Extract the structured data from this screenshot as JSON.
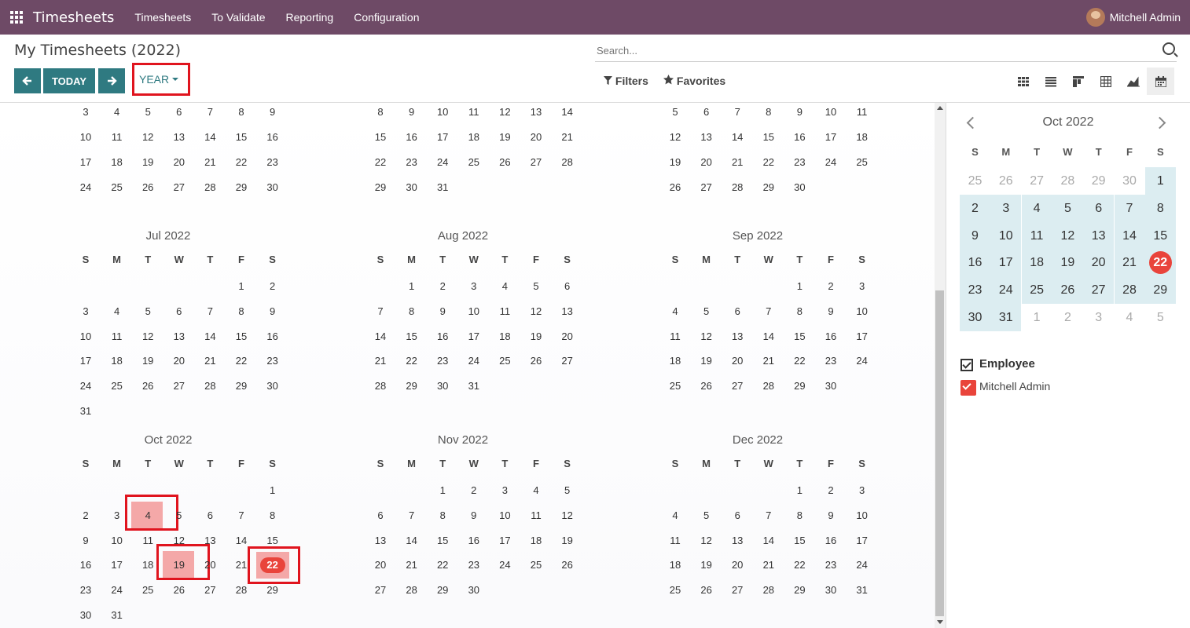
{
  "navbar": {
    "brand": "Timesheets",
    "menu": [
      "Timesheets",
      "To Validate",
      "Reporting",
      "Configuration"
    ],
    "user": "Mitchell Admin"
  },
  "control": {
    "title": "My Timesheets (2022)",
    "today_label": "TODAY",
    "scale_label": "YEAR",
    "search_placeholder": "Search...",
    "filters_label": "Filters",
    "favorites_label": "Favorites",
    "views": [
      "kanban-icon",
      "list-icon",
      "pivot-icon",
      "grid-icon",
      "graph-icon",
      "calendar-icon"
    ],
    "active_view": "calendar-icon"
  },
  "year": {
    "weekday_headers": [
      "S",
      "M",
      "T",
      "W",
      "T",
      "F",
      "S"
    ],
    "top_partial": [
      {
        "rows": [
          [
            "3",
            "4",
            "5",
            "6",
            "7",
            "8",
            "9"
          ],
          [
            "10",
            "11",
            "12",
            "13",
            "14",
            "15",
            "16"
          ],
          [
            "17",
            "18",
            "19",
            "20",
            "21",
            "22",
            "23"
          ],
          [
            "24",
            "25",
            "26",
            "27",
            "28",
            "29",
            "30"
          ]
        ]
      },
      {
        "rows": [
          [
            "8",
            "9",
            "10",
            "11",
            "12",
            "13",
            "14"
          ],
          [
            "15",
            "16",
            "17",
            "18",
            "19",
            "20",
            "21"
          ],
          [
            "22",
            "23",
            "24",
            "25",
            "26",
            "27",
            "28"
          ],
          [
            "29",
            "30",
            "31",
            "",
            "",
            "",
            ""
          ]
        ]
      },
      {
        "rows": [
          [
            "5",
            "6",
            "7",
            "8",
            "9",
            "10",
            "11"
          ],
          [
            "12",
            "13",
            "14",
            "15",
            "16",
            "17",
            "18"
          ],
          [
            "19",
            "20",
            "21",
            "22",
            "23",
            "24",
            "25"
          ],
          [
            "26",
            "27",
            "28",
            "29",
            "30",
            "",
            ""
          ]
        ]
      }
    ],
    "months": [
      {
        "title": "Jul 2022",
        "rows": [
          [
            "",
            "",
            "",
            "",
            "",
            "1",
            "2"
          ],
          [
            "3",
            "4",
            "5",
            "6",
            "7",
            "8",
            "9"
          ],
          [
            "10",
            "11",
            "12",
            "13",
            "14",
            "15",
            "16"
          ],
          [
            "17",
            "18",
            "19",
            "20",
            "21",
            "22",
            "23"
          ],
          [
            "24",
            "25",
            "26",
            "27",
            "28",
            "29",
            "30"
          ],
          [
            "31",
            "",
            "",
            "",
            "",
            "",
            ""
          ]
        ]
      },
      {
        "title": "Aug 2022",
        "rows": [
          [
            "",
            "1",
            "2",
            "3",
            "4",
            "5",
            "6"
          ],
          [
            "7",
            "8",
            "9",
            "10",
            "11",
            "12",
            "13"
          ],
          [
            "14",
            "15",
            "16",
            "17",
            "18",
            "19",
            "20"
          ],
          [
            "21",
            "22",
            "23",
            "24",
            "25",
            "26",
            "27"
          ],
          [
            "28",
            "29",
            "30",
            "31",
            "",
            "",
            ""
          ]
        ]
      },
      {
        "title": "Sep 2022",
        "rows": [
          [
            "",
            "",
            "",
            "",
            "1",
            "2",
            "3"
          ],
          [
            "4",
            "5",
            "6",
            "7",
            "8",
            "9",
            "10"
          ],
          [
            "11",
            "12",
            "13",
            "14",
            "15",
            "16",
            "17"
          ],
          [
            "18",
            "19",
            "20",
            "21",
            "22",
            "23",
            "24"
          ],
          [
            "25",
            "26",
            "27",
            "28",
            "29",
            "30",
            ""
          ]
        ]
      },
      {
        "title": "Oct 2022",
        "rows": [
          [
            "",
            "",
            "",
            "",
            "",
            "",
            "1"
          ],
          [
            "2",
            "3",
            "4",
            "5",
            "6",
            "7",
            "8"
          ],
          [
            "9",
            "10",
            "11",
            "12",
            "13",
            "14",
            "15"
          ],
          [
            "16",
            "17",
            "18",
            "19",
            "20",
            "21",
            "22"
          ],
          [
            "23",
            "24",
            "25",
            "26",
            "27",
            "28",
            "29"
          ],
          [
            "30",
            "31",
            "",
            "",
            "",
            "",
            ""
          ]
        ]
      },
      {
        "title": "Nov 2022",
        "rows": [
          [
            "",
            "",
            "1",
            "2",
            "3",
            "4",
            "5"
          ],
          [
            "6",
            "7",
            "8",
            "9",
            "10",
            "11",
            "12"
          ],
          [
            "13",
            "14",
            "15",
            "16",
            "17",
            "18",
            "19"
          ],
          [
            "20",
            "21",
            "22",
            "23",
            "24",
            "25",
            "26"
          ],
          [
            "27",
            "28",
            "29",
            "30",
            "",
            "",
            ""
          ]
        ]
      },
      {
        "title": "Dec 2022",
        "rows": [
          [
            "",
            "",
            "",
            "",
            "1",
            "2",
            "3"
          ],
          [
            "4",
            "5",
            "6",
            "7",
            "8",
            "9",
            "10"
          ],
          [
            "11",
            "12",
            "13",
            "14",
            "15",
            "16",
            "17"
          ],
          [
            "18",
            "19",
            "20",
            "21",
            "22",
            "23",
            "24"
          ],
          [
            "25",
            "26",
            "27",
            "28",
            "29",
            "30",
            "31"
          ]
        ]
      }
    ],
    "highlighted_oct": [
      "4",
      "19",
      "22"
    ],
    "today": "22"
  },
  "sidebar": {
    "title": "Oct 2022",
    "weekday_headers": [
      "S",
      "M",
      "T",
      "W",
      "T",
      "F",
      "S"
    ],
    "rows": [
      [
        "25",
        "26",
        "27",
        "28",
        "29",
        "30",
        "1"
      ],
      [
        "2",
        "3",
        "4",
        "5",
        "6",
        "7",
        "8"
      ],
      [
        "9",
        "10",
        "11",
        "12",
        "13",
        "14",
        "15"
      ],
      [
        "16",
        "17",
        "18",
        "19",
        "20",
        "21",
        "22"
      ],
      [
        "23",
        "24",
        "25",
        "26",
        "27",
        "28",
        "29"
      ],
      [
        "30",
        "31",
        "1",
        "2",
        "3",
        "4",
        "5"
      ]
    ],
    "today": "22",
    "filter_title": "Employee",
    "filter_item": "Mitchell Admin"
  },
  "colors": {
    "navbar": "#6e4a66",
    "primary": "#2f7a81",
    "today": "#e9443b",
    "highlight": "#f4a8a8",
    "annotation": "#e0141e"
  }
}
